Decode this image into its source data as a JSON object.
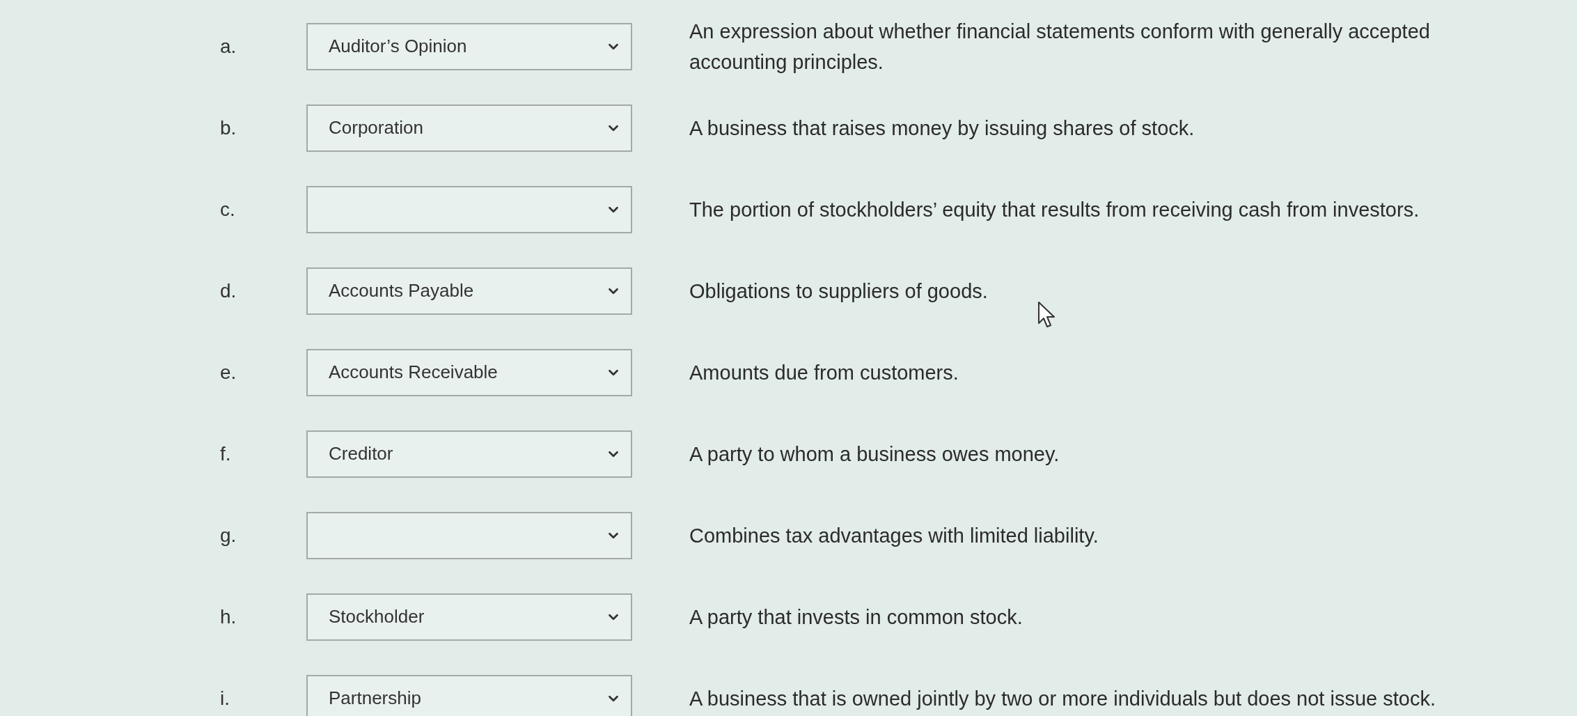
{
  "items": [
    {
      "letter": "a.",
      "value": "Auditor’s Opinion",
      "definition": "An expression about whether financial statements conform with generally accepted accounting principles."
    },
    {
      "letter": "b.",
      "value": "Corporation",
      "definition": "A business that raises money by issuing shares of stock."
    },
    {
      "letter": "c.",
      "definition": "The portion of stockholders’ equity that results from receiving cash from investors."
    },
    {
      "letter": "d.",
      "value": "Accounts Payable",
      "definition": "Obligations to suppliers of goods."
    },
    {
      "letter": "e.",
      "value": "Accounts Receivable",
      "definition": "Amounts due from customers."
    },
    {
      "letter": "f.",
      "value": "Creditor",
      "definition": "A party to whom a business owes money."
    },
    {
      "letter": "g.",
      "definition": "Combines tax advantages with limited liability."
    },
    {
      "letter": "h.",
      "value": "Stockholder",
      "definition": "A party that invests in common stock."
    },
    {
      "letter": "i.",
      "value": "Partnership",
      "definition": "A business that is owned jointly by two or more individuals but does not issue stock."
    }
  ]
}
